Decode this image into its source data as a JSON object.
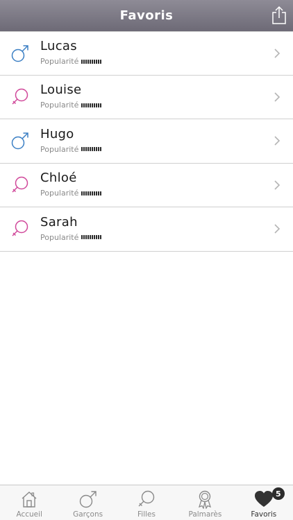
{
  "header": {
    "title": "Favoris",
    "share_icon": "share-icon"
  },
  "favorites": [
    {
      "name": "Lucas",
      "gender": "male",
      "popularity_label": "Popularité",
      "popularity_bars": 10
    },
    {
      "name": "Louise",
      "gender": "female",
      "popularity_label": "Popularité",
      "popularity_bars": 10
    },
    {
      "name": "Hugo",
      "gender": "male",
      "popularity_label": "Popularité",
      "popularity_bars": 10
    },
    {
      "name": "Chloé",
      "gender": "female",
      "popularity_label": "Popularité",
      "popularity_bars": 10
    },
    {
      "name": "Sarah",
      "gender": "female",
      "popularity_label": "Popularité",
      "popularity_bars": 10
    }
  ],
  "tabbar": {
    "tabs": [
      {
        "label": "Accueil",
        "icon": "home-icon"
      },
      {
        "label": "Garçons",
        "icon": "male-icon"
      },
      {
        "label": "Filles",
        "icon": "female-icon"
      },
      {
        "label": "Palmarès",
        "icon": "award-icon"
      },
      {
        "label": "Favoris",
        "icon": "heart-icon",
        "active": true,
        "badge": "5"
      }
    ]
  },
  "colors": {
    "male": "#3b7fc4",
    "female": "#d0489a",
    "navbar": "#7d7a86"
  }
}
